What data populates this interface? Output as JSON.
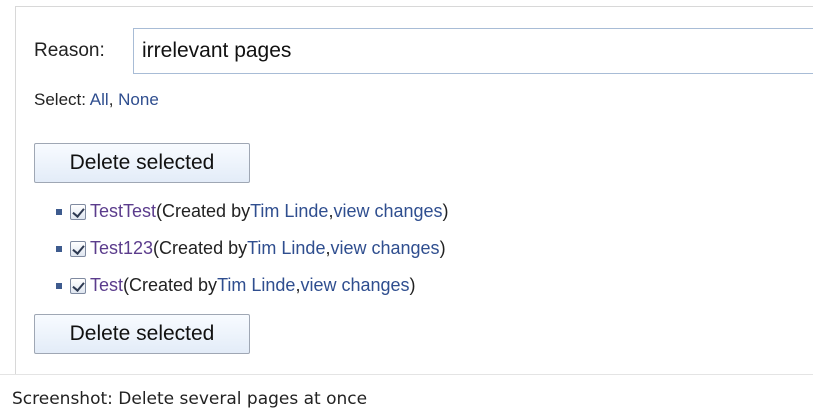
{
  "form": {
    "reason_label": "Reason:",
    "reason_value": "irrelevant pages",
    "select_prefix": "Select:",
    "select_all": "All",
    "select_sep": ",",
    "select_none": "None",
    "delete_button_label": "Delete selected"
  },
  "pages": [
    {
      "title": "TestTest",
      "checked": true,
      "open": "(Created by ",
      "author": "Tim Linde",
      "sep": ", ",
      "changes": "view changes",
      "close": ")"
    },
    {
      "title": "Test123",
      "checked": true,
      "open": "(Created by ",
      "author": "Tim Linde",
      "sep": ", ",
      "changes": "view changes",
      "close": ")"
    },
    {
      "title": "Test",
      "checked": true,
      "open": "(Created by ",
      "author": "Tim Linde",
      "sep": ", ",
      "changes": "view changes",
      "close": ")"
    }
  ],
  "caption": "Screenshot: Delete several pages at once",
  "colors": {
    "link": "#2f4e8f",
    "visited_link": "#5b3c8c",
    "input_border": "#a8bcd6",
    "button_bg": "#e3ecf8"
  },
  "icons": {
    "bullet": "square-bullet-icon",
    "checkbox": "checkbox-checked-icon"
  }
}
